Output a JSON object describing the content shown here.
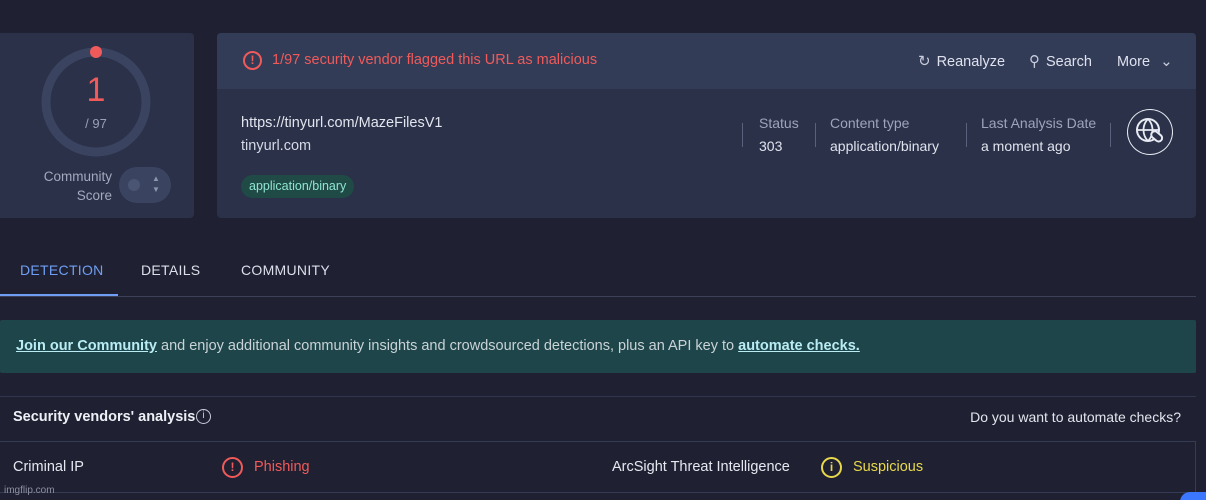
{
  "score": {
    "malicious": "1",
    "total": "/ 97",
    "ratio": 0.0103,
    "community_label": "Community\nScore",
    "colors": {
      "malicious": "#f05a5a",
      "ring": "#3a4460"
    }
  },
  "alert": {
    "icon": "alert-circle-icon",
    "text": "1/97 security vendor flagged this URL as malicious",
    "color": "#f05a5a"
  },
  "actions": {
    "reanalyze": {
      "icon": "refresh-icon",
      "label": "Reanalyze"
    },
    "search": {
      "icon": "search-icon",
      "label": "Search"
    },
    "more": {
      "icon": "chevron-down-icon",
      "label": "More"
    }
  },
  "target": {
    "url": "https://tinyurl.com/MazeFilesV1",
    "domain": "tinyurl.com",
    "tag": "application/binary"
  },
  "meta": {
    "status": {
      "label": "Status",
      "value": "303"
    },
    "content_type": {
      "label": "Content type",
      "value": "application/binary"
    },
    "last_analysis": {
      "label": "Last Analysis Date",
      "value": "a moment ago"
    }
  },
  "tabs": [
    {
      "label": "DETECTION",
      "active": true
    },
    {
      "label": "DETAILS",
      "active": false
    },
    {
      "label": "COMMUNITY",
      "active": false
    }
  ],
  "banner": {
    "link1": "Join our Community",
    "middle": " and enjoy additional community insights and crowdsourced detections, plus an API key to ",
    "link2": "automate checks."
  },
  "vendors": {
    "title": "Security vendors' analysis",
    "automate_prompt": "Do you want to automate checks?",
    "rows": [
      {
        "left": {
          "name": "Criminal IP",
          "result": "Phishing",
          "icon": "alert-circle-icon",
          "color": "#f05a5a"
        },
        "right": {
          "name": "ArcSight Threat Intelligence",
          "result": "Suspicious",
          "icon": "info-circle-icon",
          "color": "#e8d94a"
        }
      }
    ]
  },
  "watermark": "imgflip.com"
}
